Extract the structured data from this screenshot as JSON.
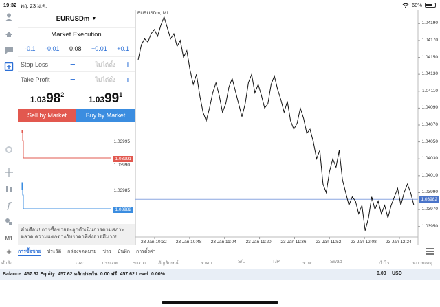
{
  "status": {
    "time": "19:32",
    "date": "พฤ. 23 ม.ค.",
    "battery": "68%",
    "battery_level": 0.68
  },
  "order_panel": {
    "symbol": "EURUSDm",
    "execution": "Market Execution",
    "volume_steps": [
      "-0.1",
      "-0.01",
      "+0.01",
      "+0.1"
    ],
    "volume": "0.08",
    "stop_loss_label": "Stop Loss",
    "take_profit_label": "Take Profit",
    "not_set": "ไม่ได้ตั้ง",
    "bid": {
      "big": "1.03",
      "mid": "98",
      "sup": "2"
    },
    "ask": {
      "big": "1.03",
      "mid": "99",
      "sup": "1"
    },
    "sell_label": "Sell by Market",
    "buy_label": "Buy by Market",
    "tick_levels_top": [
      "1.03995",
      "1.03991",
      "1.03990"
    ],
    "tick_levels_bottom": [
      "1.03985",
      "1.03982"
    ],
    "warning": "คำเตือน! การซื้อขายจะถูกดำเนินการตามสภาพตลาด ความแตกต่างกับราคาที่ส่งอาจมีมาก!"
  },
  "chart": {
    "title": "EURUSDm, M1",
    "y_labels": [
      "1.04190",
      "1.04170",
      "1.04150",
      "1.04130",
      "1.04110",
      "1.04090",
      "1.04070",
      "1.04050",
      "1.04030",
      "1.04010",
      "1.03990",
      "1.03982",
      "1.03970",
      "1.03950"
    ],
    "bid_tag": "1.03982",
    "x_labels": [
      "23 Jan 10:32",
      "23 Jan 10:48",
      "23 Jan 11:04",
      "23 Jan 11:20",
      "23 Jan 11:36",
      "23 Jan 11:52",
      "23 Jan 12:08",
      "23 Jan 12:24"
    ]
  },
  "chart_data": {
    "type": "line",
    "title": "EURUSDm, M1",
    "xlabel": "",
    "ylabel": "",
    "x": [
      "23 Jan 10:32",
      "23 Jan 10:48",
      "23 Jan 11:04",
      "23 Jan 11:20",
      "23 Jan 11:36",
      "23 Jan 11:52",
      "23 Jan 12:08",
      "23 Jan 12:24"
    ],
    "ylim": [
      1.0394,
      1.042
    ],
    "current_bid": 1.03982,
    "series": [
      {
        "values": [
          1.04147,
          1.04165,
          1.04172,
          1.04168,
          1.04178,
          1.04183,
          1.04175,
          1.04188,
          1.04198,
          1.04185,
          1.04172,
          1.04178,
          1.04163,
          1.0417,
          1.0415,
          1.04158,
          1.04135,
          1.04118,
          1.0413,
          1.04105,
          1.04085,
          1.04075,
          1.0409,
          1.04108,
          1.0412,
          1.04105,
          1.04085,
          1.04095,
          1.04115,
          1.04125,
          1.0411,
          1.04095,
          1.0408,
          1.04095,
          1.0412,
          1.0413,
          1.04108,
          1.04118,
          1.04105,
          1.0409,
          1.04095,
          1.04118,
          1.04128,
          1.04112,
          1.041,
          1.04085,
          1.04098,
          1.04075,
          1.04065,
          1.04072,
          1.0409,
          1.04078,
          1.0406,
          1.04065,
          1.0405,
          1.0403,
          1.0404,
          1.04,
          1.0399,
          1.04015,
          1.0403,
          1.0402,
          1.0404,
          1.04005,
          1.0399,
          1.03975,
          1.03985,
          1.0398,
          1.03965,
          1.03975,
          1.03945,
          1.0396,
          1.03985,
          1.0397,
          1.0398,
          1.03965,
          1.03975,
          1.0396,
          1.03975,
          1.03985,
          1.03995,
          1.03975,
          1.0399,
          1.04,
          1.0399,
          1.03975
        ]
      }
    ]
  },
  "terminal": {
    "tabs": [
      "การซื้อขาย",
      "ประวัติ",
      "กล่องจดหมาย",
      "ข่าว",
      "บันทึก",
      "การตั้งค่า"
    ],
    "active_tab": "การซื้อขาย",
    "columns": [
      "คำสั่ง",
      "เวลา",
      "ประเภท",
      "ขนาด",
      "สัญลักษณ์",
      "ราคา",
      "S/L",
      "T/P",
      "ราคา",
      "Swap",
      "กำไร",
      "หมายเหตุ"
    ],
    "balance_text": "Balance: 457.62 Equity: 457.62 หลักประกัน: 0.00 ฟรี: 457.62 Level: 0.00%",
    "total_profit": "0.00",
    "currency": "USD"
  },
  "colors": {
    "sell": "#e2584f",
    "buy": "#3b8de0",
    "accent": "#2b6fd6",
    "bid_line": "#8aa6e0"
  }
}
